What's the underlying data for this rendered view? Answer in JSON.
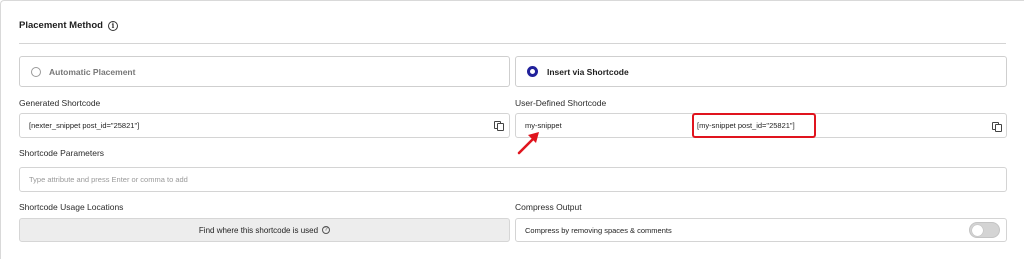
{
  "placement": {
    "title": "Placement Method",
    "info_icon": "info-icon",
    "options": [
      {
        "label": "Automatic Placement",
        "selected": false
      },
      {
        "label": "Insert via Shortcode",
        "selected": true
      }
    ]
  },
  "generated": {
    "label": "Generated Shortcode",
    "value": "[nexter_snippet post_id=\"25821\"]",
    "icon": "copy-icon"
  },
  "user_defined": {
    "label": "User-Defined Shortcode",
    "name_value": "my-snippet",
    "shortcode_value": "[my-snippet post_id=\"25821\"]",
    "icon": "copy-icon"
  },
  "params": {
    "label": "Shortcode Parameters",
    "placeholder": "Type attribute and press Enter or comma to add"
  },
  "usage": {
    "label": "Shortcode Usage Locations",
    "button_label": "Find where this shortcode is used",
    "help_icon": "help-icon"
  },
  "compress": {
    "label": "Compress Output",
    "option_label": "Compress by removing spaces & comments",
    "enabled": false
  },
  "colors": {
    "accent": "#21219b",
    "annotation": "#e0141e"
  }
}
